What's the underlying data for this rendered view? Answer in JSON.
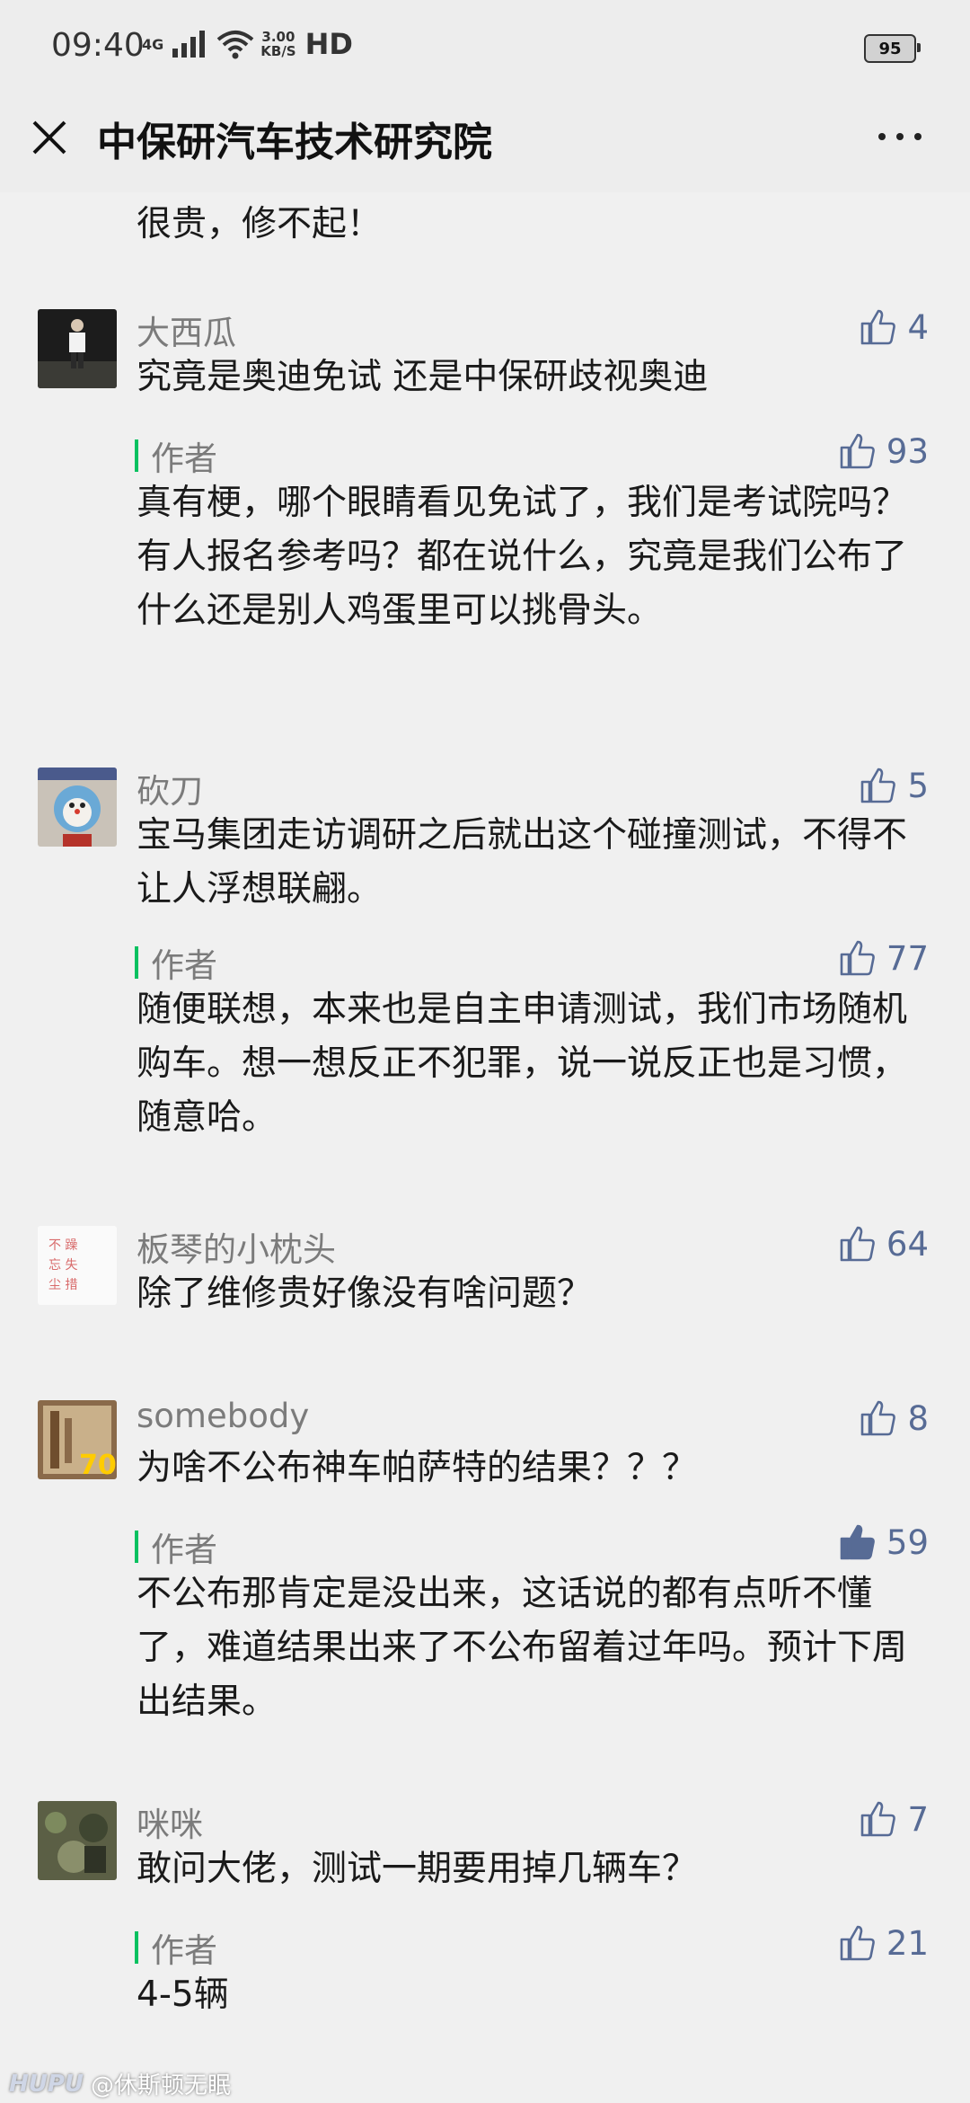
{
  "status_bar": {
    "time": "09:40",
    "network": "4G",
    "speed_value": "3.00",
    "speed_unit": "KB/S",
    "hd": "HD",
    "battery": "95"
  },
  "header": {
    "title": "中保研汽车技术研究院",
    "close_icon": "close-icon",
    "more_icon": "more-icon"
  },
  "colors": {
    "like_blue": "#576b95",
    "author_green": "#07c160",
    "text": "#1a1a1a",
    "muted": "#7b7b7b"
  },
  "comments": [
    {
      "text": "很贵，修不起！"
    },
    {
      "name": "大西瓜",
      "text": "究竟是奥迪免试 还是中保研歧视奥迪",
      "likes": "4",
      "reply": {
        "author_label": "作者",
        "likes": "93",
        "text": "真有梗，哪个眼睛看见免试了，我们是考试院吗？有人报名参考吗？都在说什么，究竟是我们公布了什么还是别人鸡蛋里可以挑骨头。"
      }
    },
    {
      "name": "砍刀",
      "text": "宝马集团走访调研之后就出这个碰撞测试，不得不让人浮想联翩。",
      "likes": "5",
      "reply": {
        "author_label": "作者",
        "likes": "77",
        "text": "随便联想，本来也是自主申请测试，我们市场随机购车。想一想反正不犯罪，说一说反正也是习惯，随意哈。"
      }
    },
    {
      "name": "板琴的小枕头",
      "text": "除了维修贵好像没有啥问题？",
      "likes": "64"
    },
    {
      "name": "somebody",
      "text": "为啥不公布神车帕萨特的结果？？？",
      "likes": "8",
      "reply": {
        "author_label": "作者",
        "likes": "59",
        "liked": true,
        "text": "不公布那肯定是没出来，这话说的都有点听不懂了，难道结果出来了不公布留着过年吗。预计下周出结果。"
      }
    },
    {
      "name": "咪咪",
      "text": "敢问大佬，测试一期要用掉几辆车？",
      "likes": "7",
      "reply": {
        "author_label": "作者",
        "likes": "21",
        "text": "4-5辆"
      }
    }
  ],
  "watermark": {
    "brand": "HUPU",
    "user": "@休斯顿无眠"
  }
}
